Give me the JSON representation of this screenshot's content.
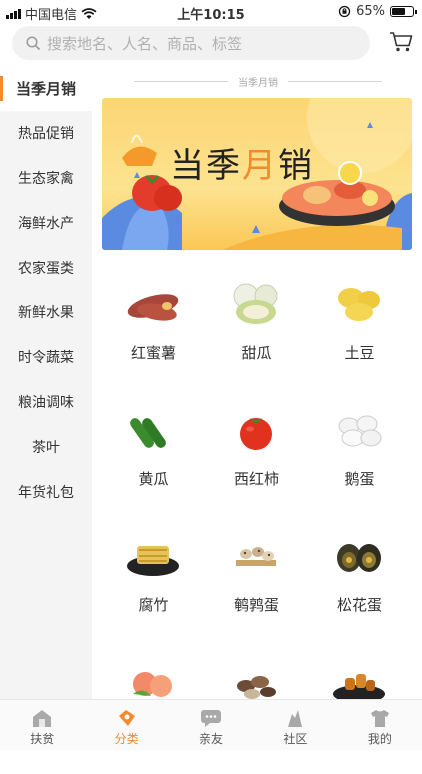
{
  "status": {
    "carrier": "中国电信",
    "time": "上午10:15",
    "battery": "65%",
    "battery_level": 0.65
  },
  "search": {
    "placeholder": "搜索地名、人名、商品、标签"
  },
  "sidebar": {
    "items": [
      {
        "label": "当季月销",
        "active": true
      },
      {
        "label": "热品促销"
      },
      {
        "label": "生态家禽"
      },
      {
        "label": "海鲜水产"
      },
      {
        "label": "农家蛋类"
      },
      {
        "label": "新鲜水果"
      },
      {
        "label": "时令蔬菜"
      },
      {
        "label": "粮油调味"
      },
      {
        "label": "茶叶"
      },
      {
        "label": "年货礼包"
      }
    ]
  },
  "section": {
    "title": "当季月销"
  },
  "banner": {
    "title_a": "当季",
    "title_b": "月",
    "title_c": "销"
  },
  "products": [
    {
      "name": "红蜜薯",
      "icon": "sweet-potato-icon"
    },
    {
      "name": "甜瓜",
      "icon": "melon-icon"
    },
    {
      "name": "土豆",
      "icon": "potato-icon"
    },
    {
      "name": "黄瓜",
      "icon": "cucumber-icon"
    },
    {
      "name": "西红柿",
      "icon": "tomato-icon"
    },
    {
      "name": "鹅蛋",
      "icon": "goose-egg-icon"
    },
    {
      "name": "腐竹",
      "icon": "tofu-skin-icon"
    },
    {
      "name": "鹌鹑蛋",
      "icon": "quail-egg-icon"
    },
    {
      "name": "松花蛋",
      "icon": "century-egg-icon"
    },
    {
      "name": "",
      "icon": "peach-icon"
    },
    {
      "name": "",
      "icon": "mushroom-icon"
    },
    {
      "name": "",
      "icon": "snack-icon"
    }
  ],
  "tabs": [
    {
      "label": "扶贫",
      "icon": "house-icon"
    },
    {
      "label": "分类",
      "icon": "category-icon",
      "active": true
    },
    {
      "label": "亲友",
      "icon": "chat-icon"
    },
    {
      "label": "社区",
      "icon": "community-icon"
    },
    {
      "label": "我的",
      "icon": "profile-icon"
    }
  ],
  "colors": {
    "accent": "#f28a2e",
    "sidebar_bg": "#f4f4f4",
    "banner_bg": "#fcd574"
  }
}
